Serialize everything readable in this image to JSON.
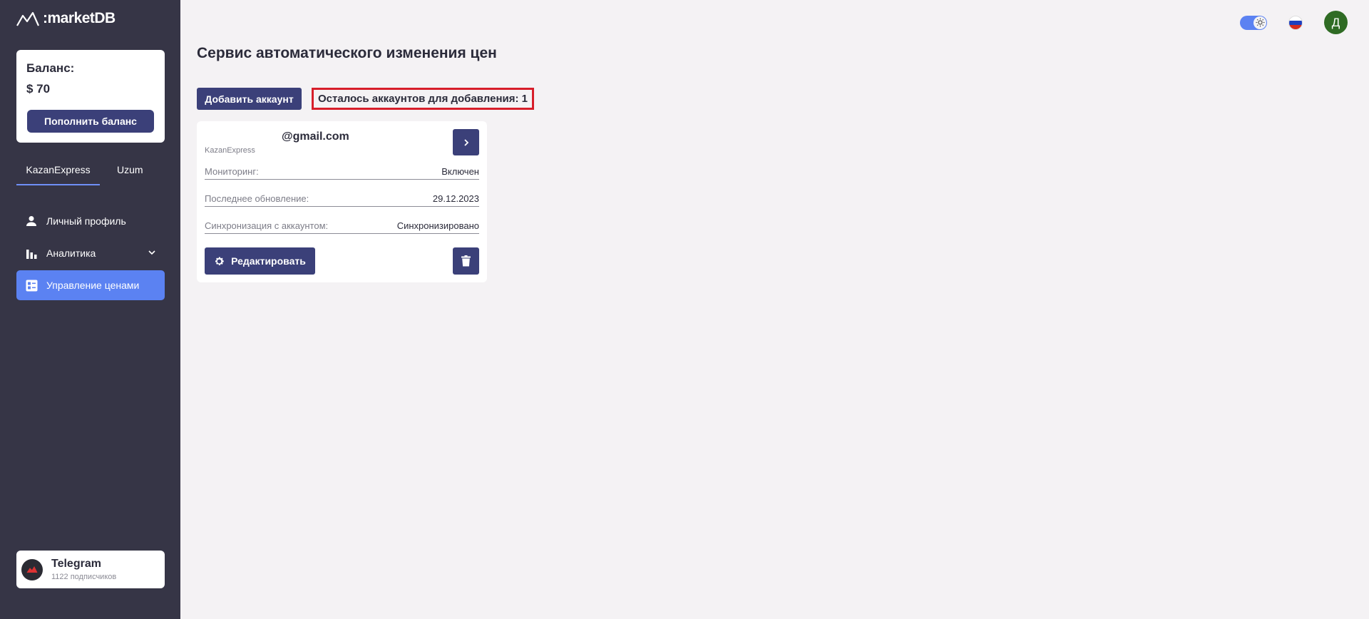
{
  "brand": {
    "name": ":marketDB"
  },
  "balance": {
    "label": "Баланс:",
    "value": "$ 70",
    "topup_label": "Пополнить баланс"
  },
  "markets": [
    {
      "label": "KazanExpress",
      "active": true
    },
    {
      "label": "Uzum",
      "active": false
    }
  ],
  "nav": {
    "items": [
      {
        "label": "Личный профиль",
        "icon": "user-icon"
      },
      {
        "label": "Аналитика",
        "icon": "bar-chart-icon"
      },
      {
        "label": "Управление ценами",
        "icon": "price-list-icon",
        "active": true
      }
    ]
  },
  "telegram": {
    "title": "Telegram",
    "subscribers": "1122 подписчиков"
  },
  "topbar": {
    "avatar_letter": "Д"
  },
  "page": {
    "title": "Сервис автоматического изменения цен",
    "add_account_label": "Добавить аккаунт",
    "remaining_label": "Осталось аккаунтов для добавления: 1"
  },
  "account": {
    "email": "@gmail.com",
    "market": "KazanExpress",
    "rows": [
      {
        "key": "Мониторинг:",
        "value": "Включен"
      },
      {
        "key": "Последнее обновление:",
        "value": "29.12.2023"
      },
      {
        "key": "Синхронизация с аккаунтом:",
        "value": "Синхронизировано"
      }
    ],
    "edit_label": "Редактировать"
  },
  "colors": {
    "sidebar": "#363546",
    "primary_button": "#3b4079",
    "active_nav": "#5b82f2",
    "highlight_border": "#d71e2a",
    "avatar_bg": "#2f6b24"
  }
}
